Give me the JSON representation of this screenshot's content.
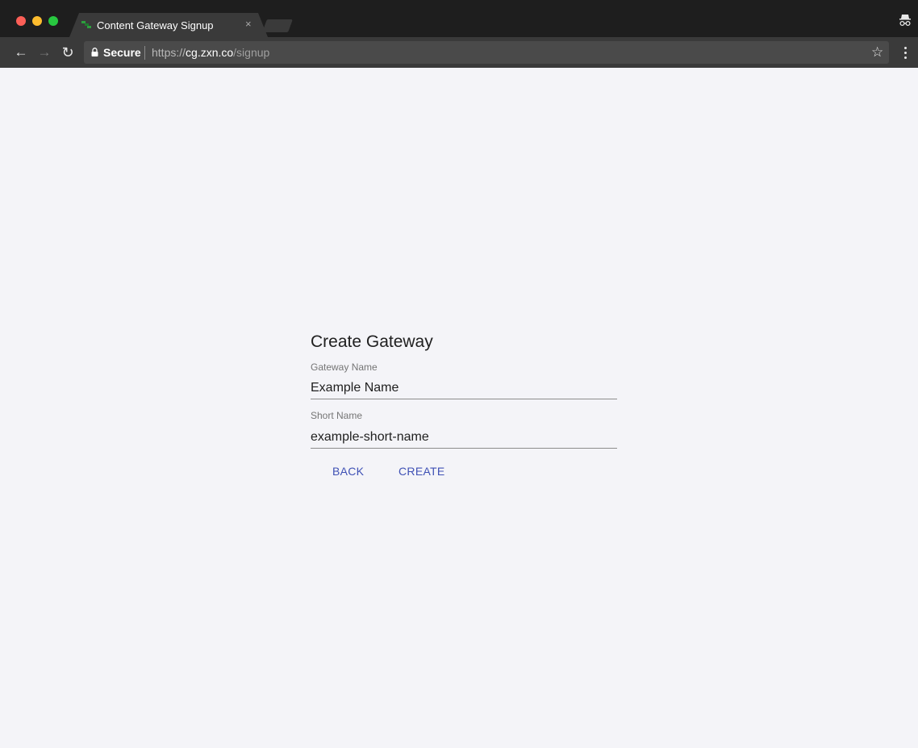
{
  "browser": {
    "tab": {
      "title": "Content Gateway Signup",
      "close_glyph": "×",
      "favicon": "content-gateway-logo-icon"
    },
    "toolbar": {
      "back_glyph": "←",
      "forward_glyph": "→",
      "reload_glyph": "↻",
      "secure_label": "Secure",
      "url_scheme": "https://",
      "url_host": "cg.zxn.co",
      "url_path": "/signup",
      "bookmark_glyph": "☆"
    },
    "colors": {
      "tabstrip": "#1e1e1e",
      "toolbar": "#3a3a3a",
      "omnibox": "#4a4a4a",
      "page_background": "#f4f4f8"
    }
  },
  "form": {
    "title": "Create Gateway",
    "gateway_name": {
      "label": "Gateway Name",
      "value": "Example Name"
    },
    "short_name": {
      "label": "Short Name",
      "value": "example-short-name"
    },
    "back_label": "BACK",
    "create_label": "CREATE",
    "accent_color": "#3f51b5"
  }
}
